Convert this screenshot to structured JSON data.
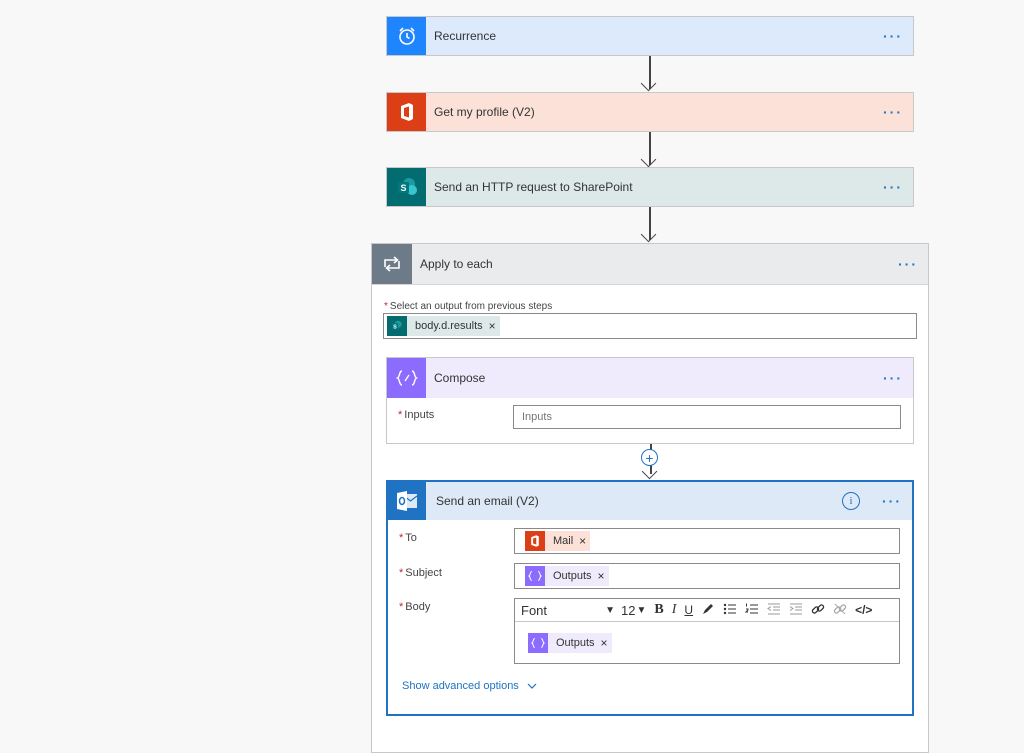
{
  "steps": {
    "recurrence": {
      "title": "Recurrence",
      "more": "···",
      "color": "#1f85ff"
    },
    "profile": {
      "title": "Get my profile (V2)",
      "more": "···",
      "color": "#dc3e15"
    },
    "sharepoint": {
      "title": "Send an HTTP request to SharePoint",
      "more": "···",
      "color": "#036c70"
    }
  },
  "apply_each": {
    "title": "Apply to each",
    "more": "···",
    "select_label": "Select an output from previous steps",
    "required_mark": "*",
    "token": "body.d.results",
    "token_remove": "×"
  },
  "compose": {
    "title": "Compose",
    "more": "···",
    "inputs_label": "Inputs",
    "inputs_placeholder": "Inputs",
    "color": "#8c6cff"
  },
  "add_step": {
    "symbol": "+"
  },
  "email": {
    "title": "Send an email (V2)",
    "info": "i",
    "more": "···",
    "to_label": "To",
    "to_token": "Mail",
    "subject_label": "Subject",
    "subject_token": "Outputs",
    "body_label": "Body",
    "body_token": "Outputs",
    "token_remove": "×",
    "toolbar": {
      "font": "Font",
      "font_arrow": "▼",
      "size": "12",
      "size_arrow": "▼",
      "bold": "B",
      "italic": "I",
      "underline": "U",
      "code": "</>"
    },
    "advanced": "Show advanced options",
    "accent": "#1f73c2"
  }
}
